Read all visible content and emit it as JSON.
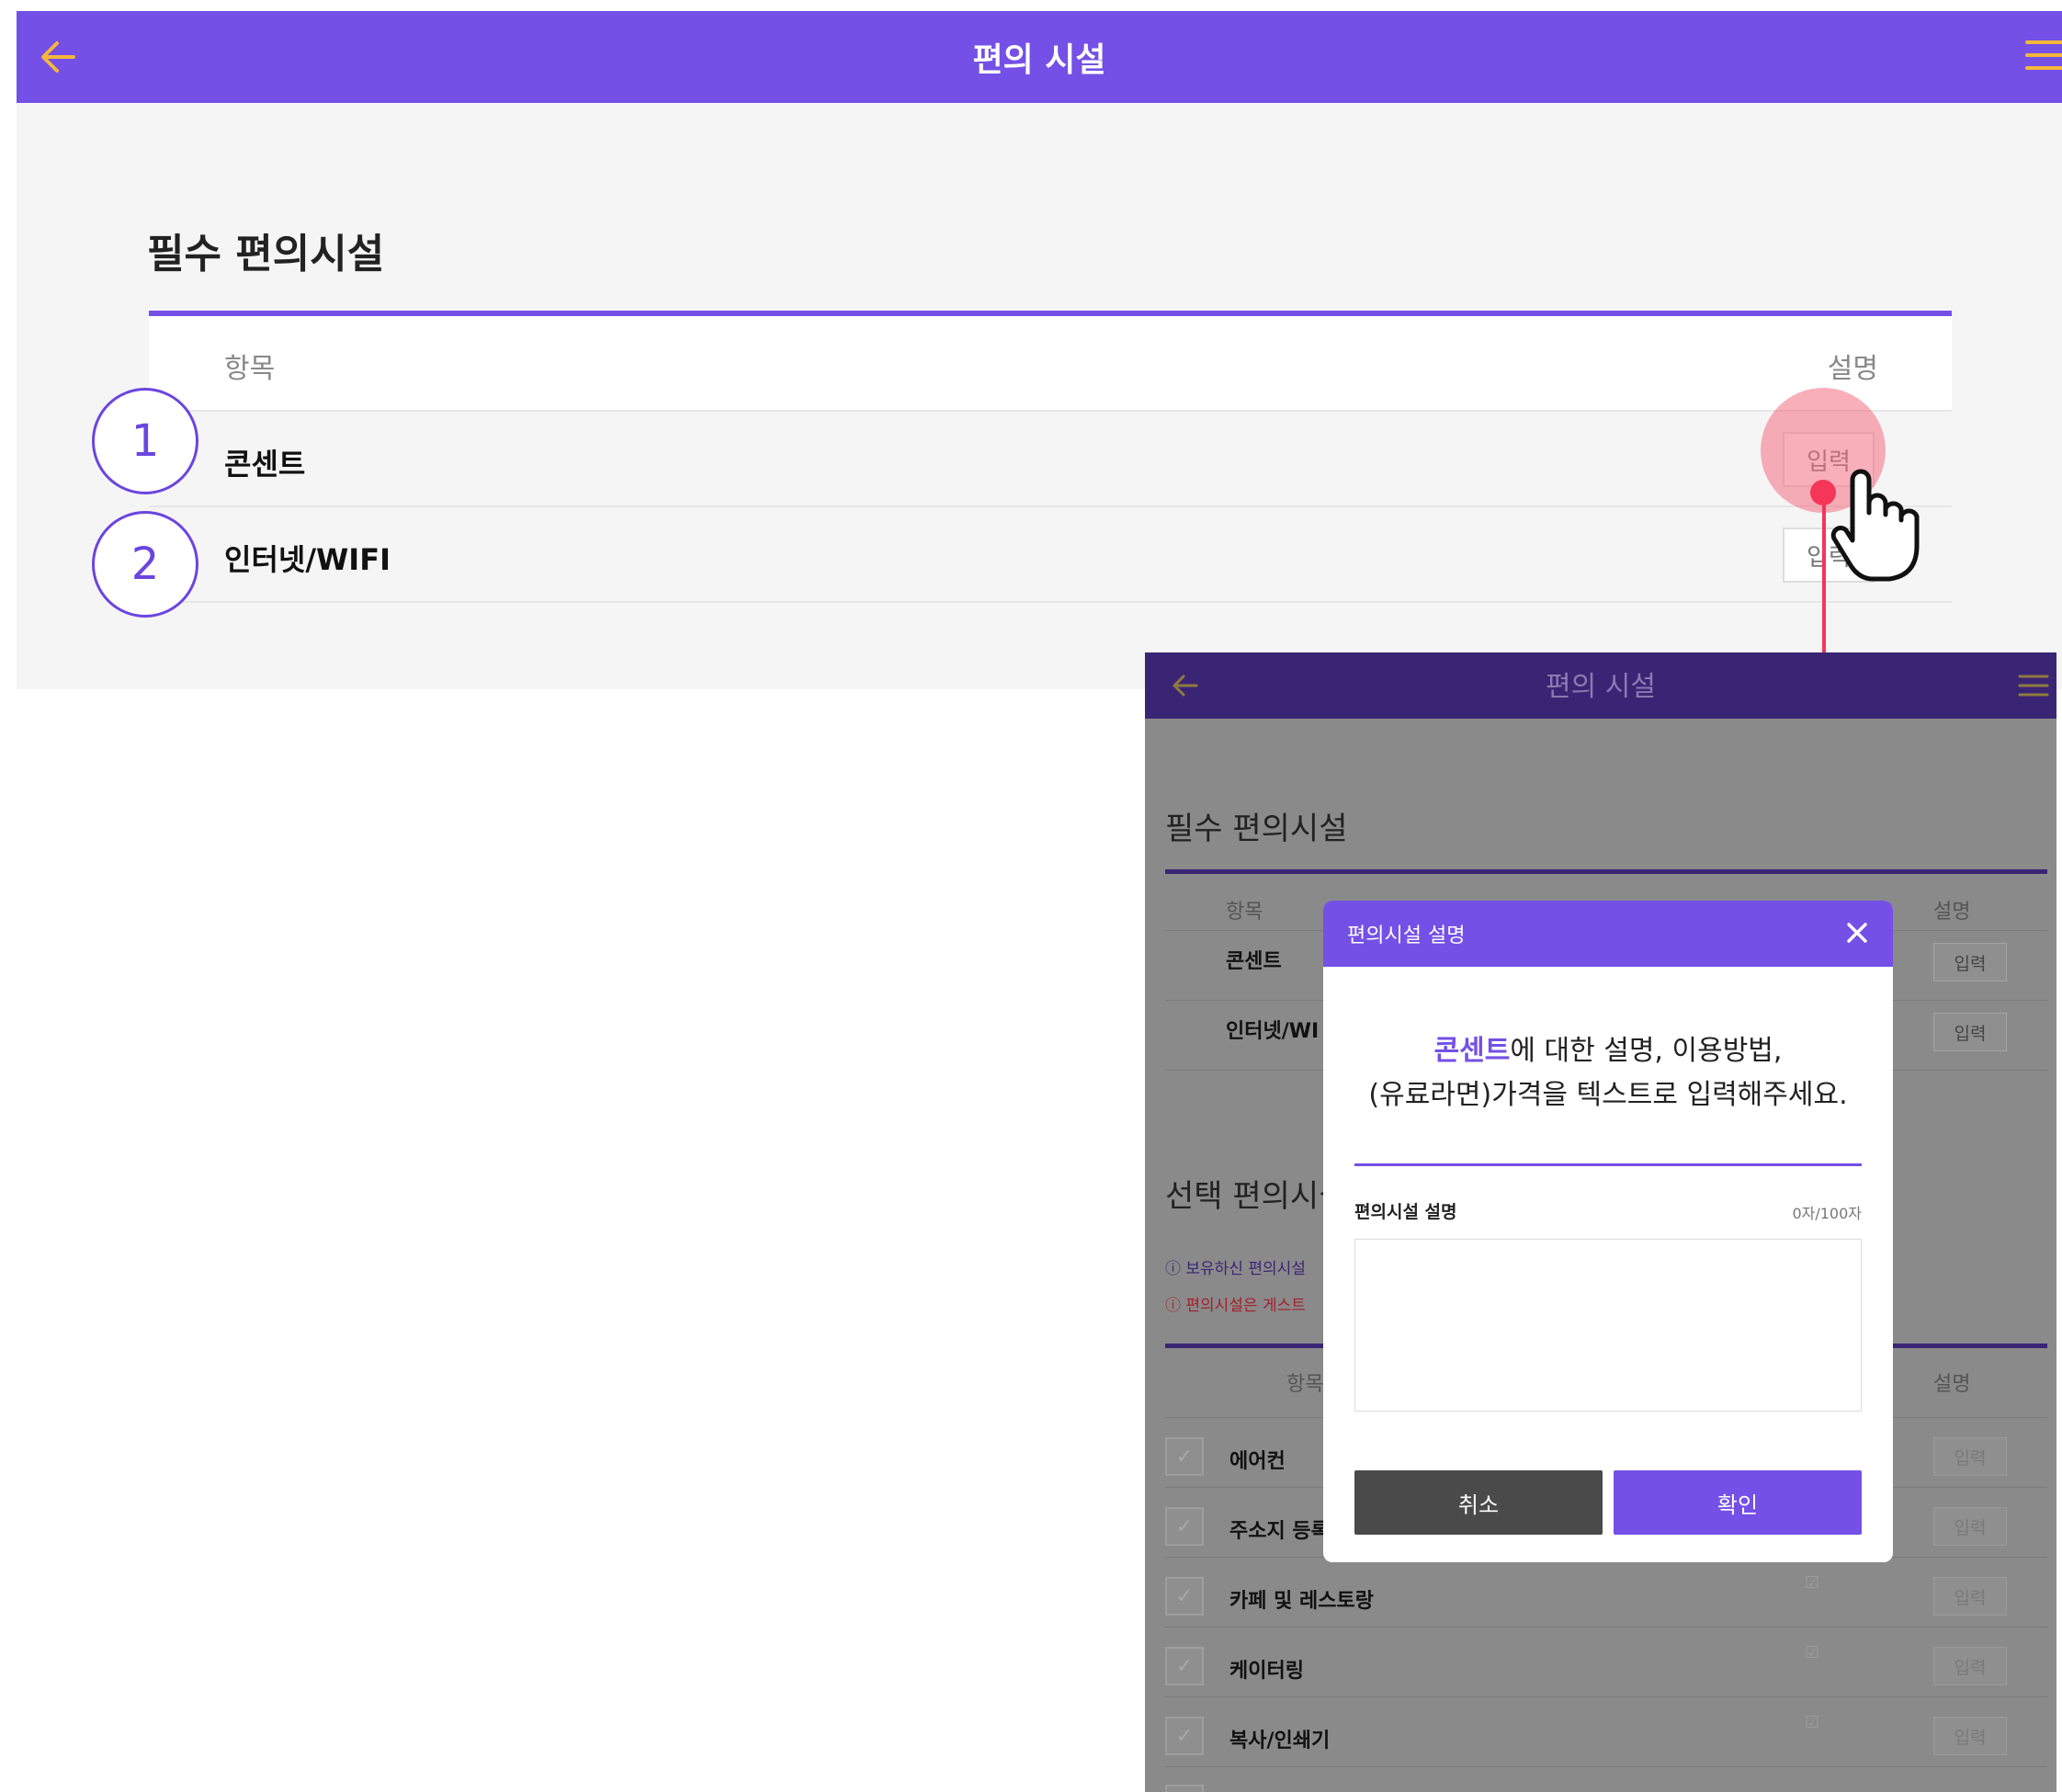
{
  "main": {
    "header_title": "편의 시설",
    "section_title": "필수 편의시설",
    "table_header": {
      "col_item": "항목",
      "col_desc": "설명"
    },
    "rows": [
      {
        "number": "1",
        "name": "콘센트",
        "button": "입력"
      },
      {
        "number": "2",
        "name": "인터넷/WIFI",
        "button": "입력"
      }
    ]
  },
  "second": {
    "header_title": "편의 시설",
    "section1_title": "필수 편의시설",
    "table_header": {
      "col_item": "항목",
      "col_desc": "설명"
    },
    "rows1": [
      {
        "name": "콘센트",
        "button": "입력"
      },
      {
        "name": "인터넷/WI",
        "button": "입력"
      }
    ],
    "section2_title": "선택 편의시설",
    "note1": "보유하신 편의시설",
    "note2": "편의시설은 게스트",
    "table2_header": {
      "col_item": "항목",
      "col_desc": "설명"
    },
    "rows2": [
      {
        "name": "에어컨",
        "button": "입력"
      },
      {
        "name": "주소지 등록",
        "button": "입력"
      },
      {
        "name": "카페 및 레스토랑",
        "button": "입력"
      },
      {
        "name": "케이터링",
        "button": "입력"
      },
      {
        "name": "복사/인쇄기",
        "button": "입력"
      }
    ]
  },
  "modal": {
    "title": "편의시설 설명",
    "desc_highlight": "콘센트",
    "desc_line1_rest": "에 대한 설명, 이용방법,",
    "desc_line2": "(유료라면)가격을 텍스트로 입력해주세요.",
    "field_label": "편의시설 설명",
    "char_count": "0자/100자",
    "textarea_value": "",
    "cancel_label": "취소",
    "confirm_label": "확인"
  },
  "colors": {
    "brand": "#7450e6",
    "header_dim": "#3a2575",
    "pointer_red": "#f43658",
    "icon_yellow": "#f5b63a"
  }
}
